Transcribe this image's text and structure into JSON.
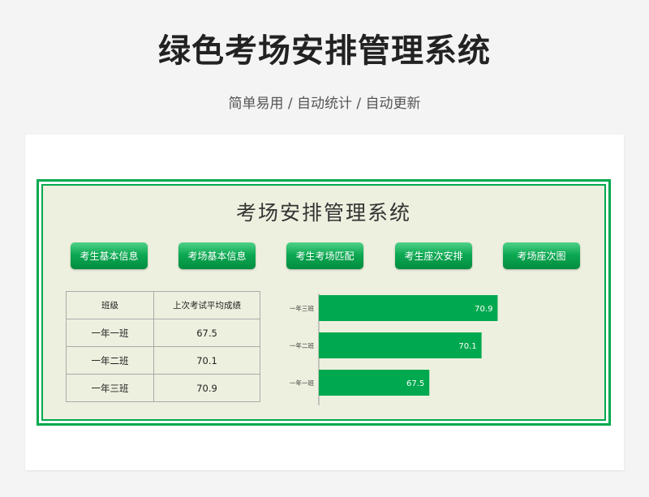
{
  "header": {
    "title": "绿色考场安排管理系统",
    "subtitle": "简单易用 / 自动统计 / 自动更新"
  },
  "app": {
    "title": "考场安排管理系统",
    "nav": [
      {
        "label": "考生基本信息"
      },
      {
        "label": "考场基本信息"
      },
      {
        "label": "考生考场匹配"
      },
      {
        "label": "考生座次安排"
      },
      {
        "label": "考场座次图"
      }
    ]
  },
  "table": {
    "headers": [
      "班级",
      "上次考试平均成绩"
    ],
    "rows": [
      [
        "一年一班",
        "67.5"
      ],
      [
        "一年二班",
        "70.1"
      ],
      [
        "一年三班",
        "70.9"
      ]
    ]
  },
  "colors": {
    "accent": "#00a94f",
    "panel_bg": "#eef0df"
  },
  "chart_data": {
    "type": "bar",
    "orientation": "horizontal",
    "categories": [
      "一年三班",
      "一年二班",
      "一年一班"
    ],
    "values": [
      70.9,
      70.1,
      67.5
    ],
    "xlim": [
      62,
      75
    ],
    "color": "#00a94f",
    "data_labels": true,
    "grid": false
  }
}
